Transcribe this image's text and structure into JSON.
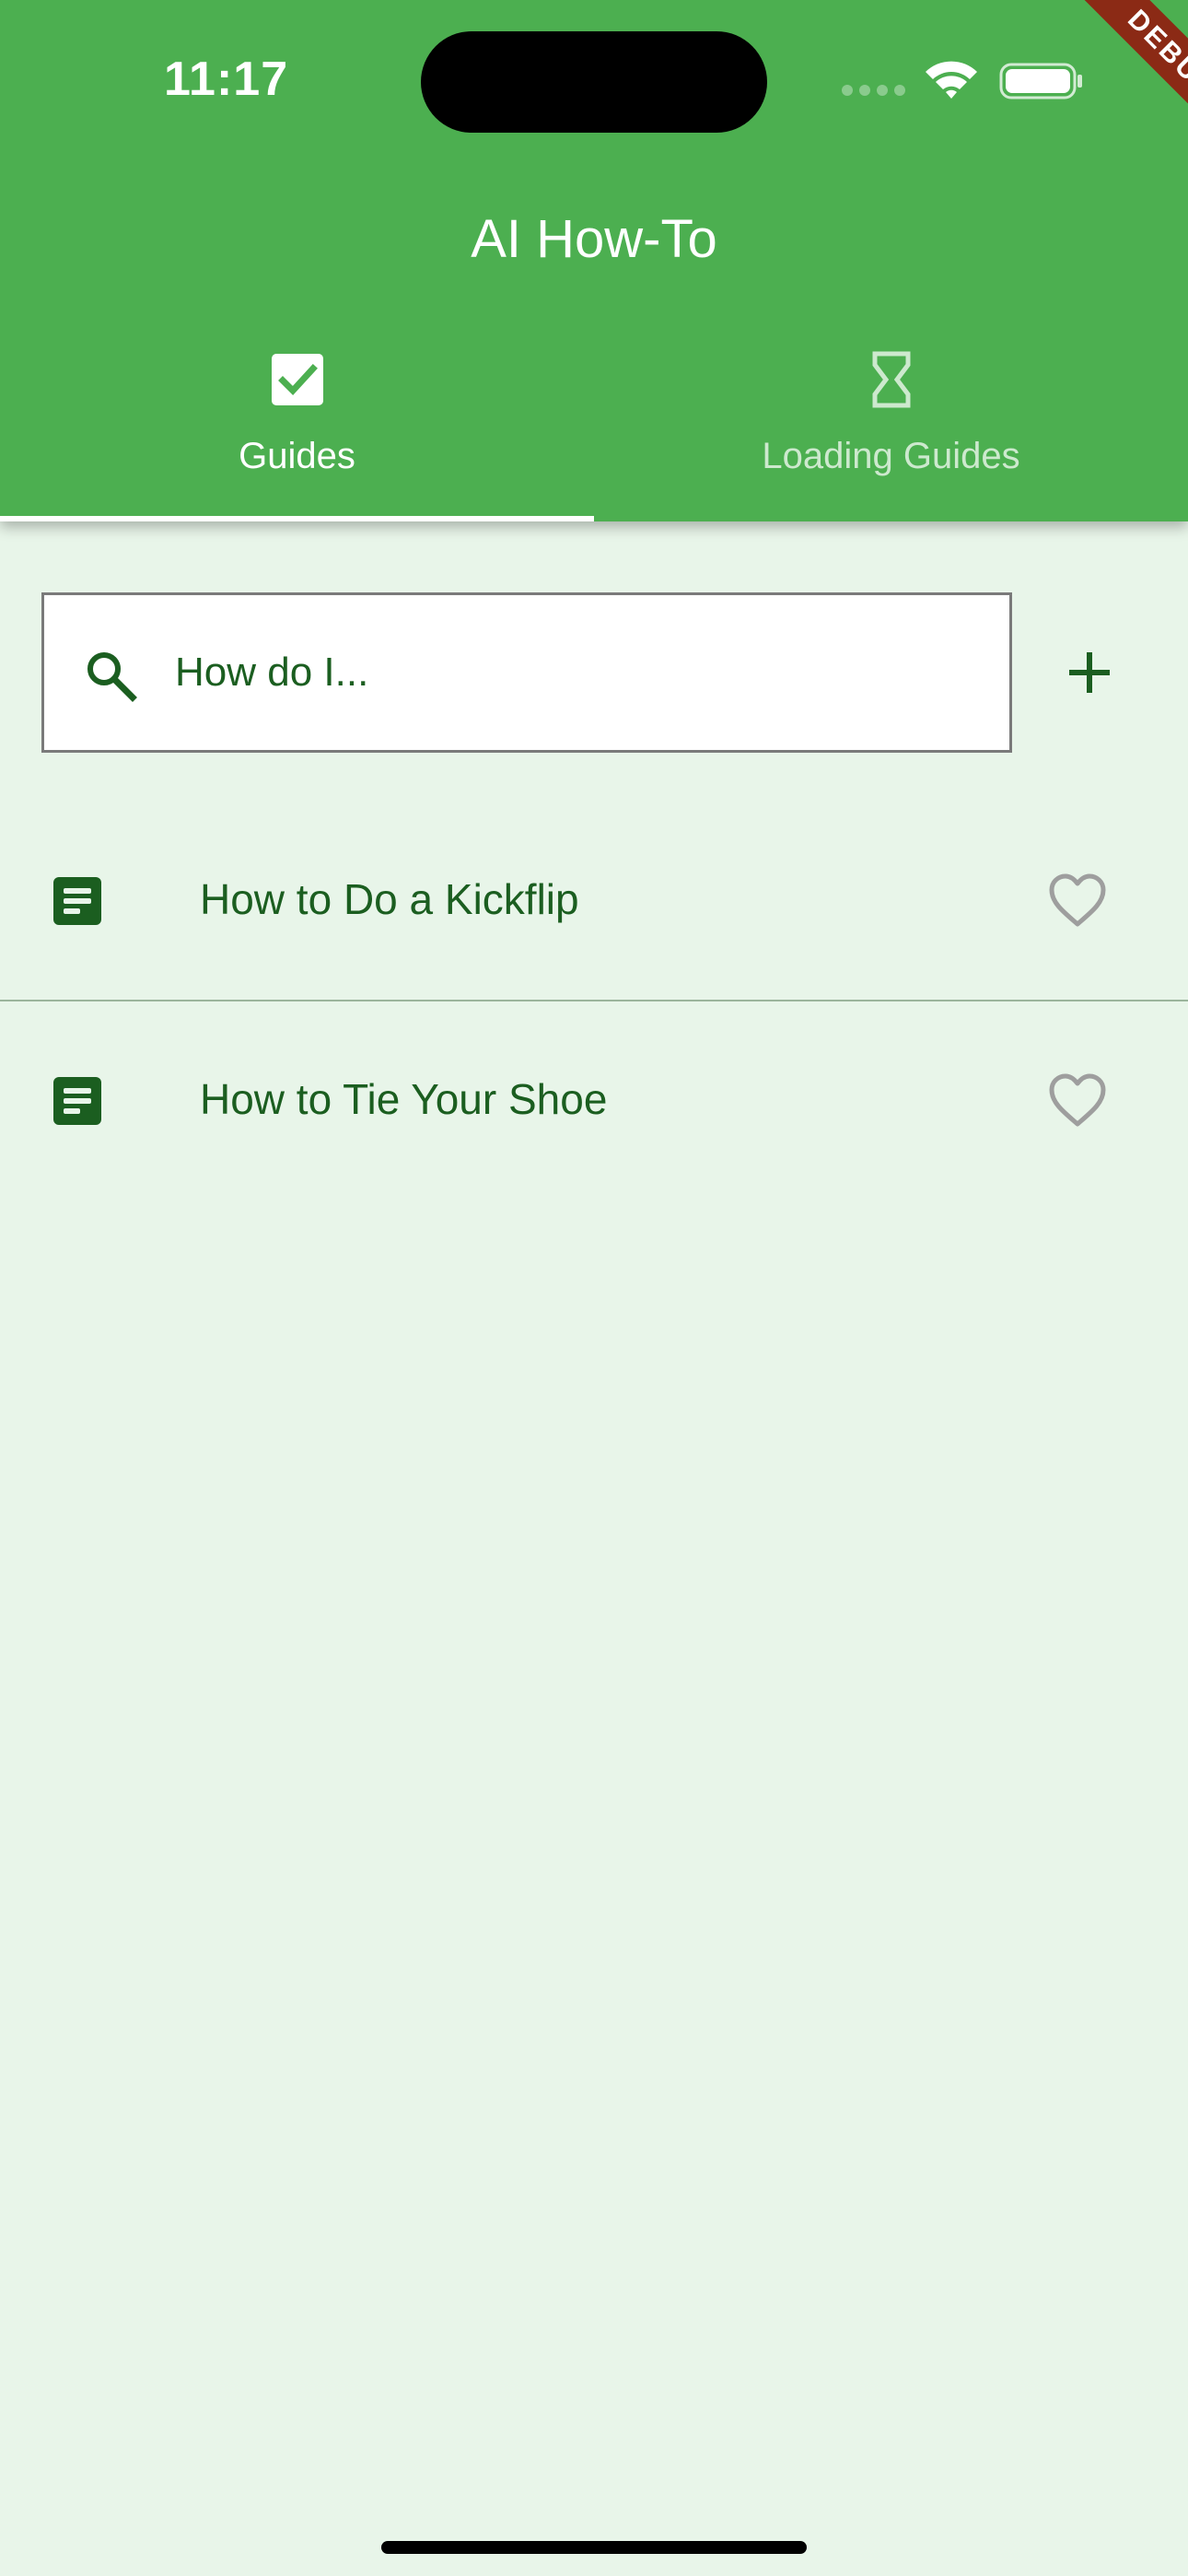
{
  "status_bar": {
    "time": "11:17"
  },
  "debug_banner": {
    "label": "DEBUG"
  },
  "app_bar": {
    "title": "AI How-To",
    "tabs": [
      {
        "label": "Guides",
        "icon": "checkbox-checked-icon",
        "selected": true
      },
      {
        "label": "Loading Guides",
        "icon": "hourglass-icon",
        "selected": false
      }
    ]
  },
  "search": {
    "placeholder": "How do I...",
    "value": "",
    "icon": "search-icon"
  },
  "add_button": {
    "icon": "plus-icon"
  },
  "guides": [
    {
      "title": "How to Do a Kickflip",
      "icon": "document-icon",
      "favorite": false
    },
    {
      "title": "How to Tie Your Shoe",
      "icon": "document-icon",
      "favorite": false
    }
  ],
  "colors": {
    "app_bar": "#4caf50",
    "background": "#e8f5e9",
    "text_primary": "#1b5e20",
    "heart_outline": "#9e9e9e",
    "debug_ribbon": "#8b2a15"
  }
}
